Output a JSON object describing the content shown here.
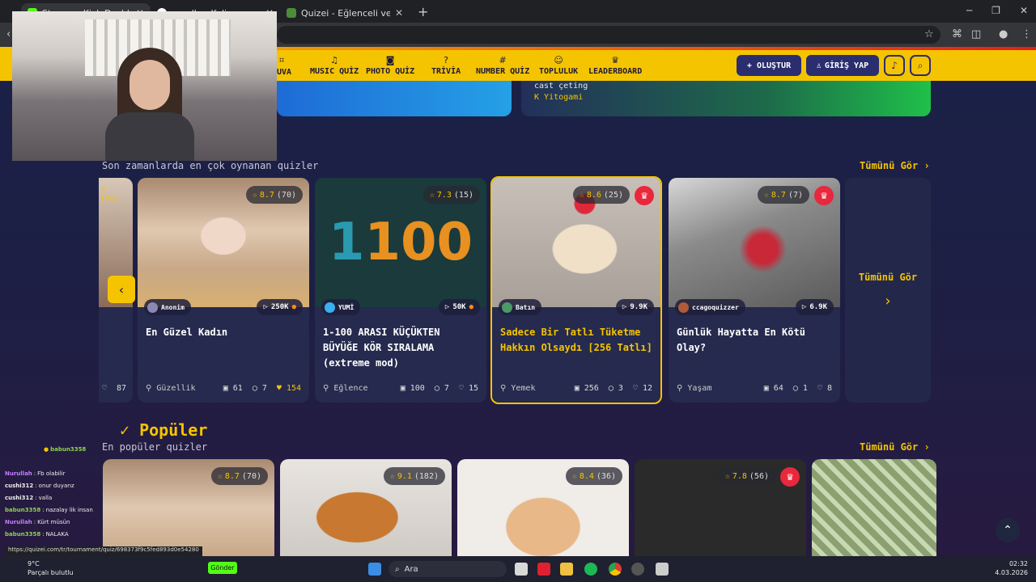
{
  "browser": {
    "tabs": [
      {
        "label": "Stream - Kick Dashboard",
        "fav": "#53fc18"
      },
      {
        "label": "parolla - Kelime oyunu, Günlük",
        "fav": "#ffffff"
      },
      {
        "label": "Quizei - Eğlenceli ve etkileşimli",
        "fav": "#4a8c3a"
      }
    ],
    "new_tab": "+",
    "close": "✕"
  },
  "nav": {
    "items": [
      {
        "label": "MUVA",
        "icon": "grid-icon"
      },
      {
        "label": "MUSIC QUİZ",
        "icon": "music-icon"
      },
      {
        "label": "PHOTO QUİZ",
        "icon": "camera-icon"
      },
      {
        "label": "TRİVİA",
        "icon": "question-icon"
      },
      {
        "label": "NUMBER QUİZ",
        "icon": "hash-icon"
      },
      {
        "label": "TOPLULUK",
        "icon": "users-icon"
      },
      {
        "label": "LEADERBOARD",
        "icon": "trophy-icon"
      }
    ],
    "create": "+ OLUŞTUR",
    "login": "GİRİŞ YAP"
  },
  "hero": {
    "text": "cast çeting",
    "author": "Yitogami"
  },
  "recent": {
    "subtitle": "Son zamanlarda en çok oynanan quizler",
    "see_all": "Tümünü Gör ›",
    "partial_rating": "3 (76)",
    "partial_likes": "87",
    "cards": [
      {
        "rating": "8.7",
        "count": "(70)",
        "author": "Anonim",
        "plays": "250K",
        "title": "En Güzel Kadın",
        "category": "Güzellik",
        "questions": "61",
        "comments": "7",
        "likes": "154",
        "crown": false
      },
      {
        "rating": "7.3",
        "count": "(15)",
        "author": "YUMİ",
        "plays": "50K",
        "title": "1-100 ARASI KÜÇÜKTEN BÜYÜĞE KÖR SIRALAMA (extreme mod)",
        "category": "Eğlence",
        "questions": "100",
        "comments": "7",
        "likes": "15",
        "crown": false
      },
      {
        "rating": "8.6",
        "count": "(25)",
        "author": "Batın",
        "plays": "9.9K",
        "title": "Sadece Bir Tatlı Tüketme Hakkın Olsaydı [256 Tatlı]",
        "category": "Yemek",
        "questions": "256",
        "comments": "3",
        "likes": "12",
        "crown": true
      },
      {
        "rating": "8.7",
        "count": "(7)",
        "author": "ccagoquizzer",
        "plays": "6.9K",
        "title": "Günlük Hayatta En Kötü Olay?",
        "category": "Yaşam",
        "questions": "64",
        "comments": "1",
        "likes": "8",
        "crown": true
      }
    ],
    "more": "Tümünü Gör"
  },
  "popular": {
    "title": "Popüler",
    "subtitle": "En popüler quizler",
    "see_all": "Tümünü Gör ›",
    "cards": [
      {
        "rating": "8.7",
        "count": "(70)"
      },
      {
        "rating": "9.1",
        "count": "(182)"
      },
      {
        "rating": "8.4",
        "count": "(36)"
      },
      {
        "rating": "7.8",
        "count": "(56)"
      },
      {
        "rating": "",
        "count": ""
      }
    ]
  },
  "chat": {
    "top_user": "babun3358",
    "messages": [
      {
        "user": "Nurullah",
        "text": "Fb olabilir",
        "color": "#c77dff"
      },
      {
        "user": "cushi312",
        "text": "onur duyarız",
        "color": "#ffffff"
      },
      {
        "user": "cushi312",
        "text": "valla",
        "color": "#ffffff"
      },
      {
        "user": "babun3358",
        "text": "nazalay lik insan",
        "color": "#8fd14f"
      },
      {
        "user": "Nurullah",
        "text": "Kürt müsün",
        "color": "#c77dff"
      },
      {
        "user": "babun3358",
        "text": "NALAKA",
        "color": "#8fd14f"
      }
    ],
    "send": "Gönder",
    "status_url": "https://quizei.com/tr/tournament/quiz/698373f9c5fed893d0e54280"
  },
  "taskbar": {
    "weather_temp": "9°C",
    "weather_desc": "Parçalı bulutlu",
    "search": "Ara",
    "time": "02:32",
    "date": "4.03.2026"
  }
}
